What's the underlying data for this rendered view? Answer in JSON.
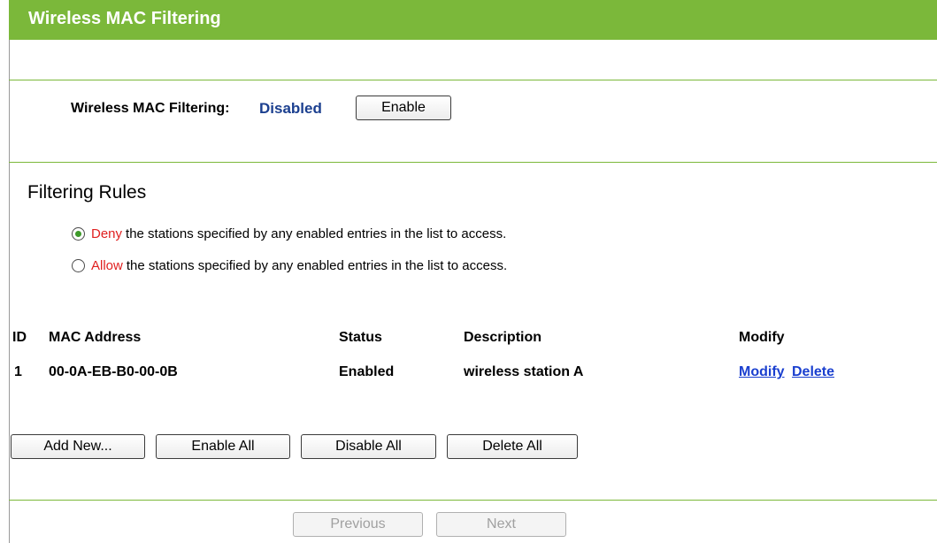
{
  "header": {
    "title": "Wireless MAC Filtering"
  },
  "status": {
    "label": "Wireless MAC Filtering:",
    "value": "Disabled",
    "enable_button": "Enable"
  },
  "rules": {
    "title": "Filtering Rules",
    "options": [
      {
        "keyword": "Deny",
        "text": "the stations specified by any enabled entries in the list to access.",
        "checked": true
      },
      {
        "keyword": "Allow",
        "text": "the stations specified by any enabled entries in the list to access.",
        "checked": false
      }
    ]
  },
  "table": {
    "columns": [
      "ID",
      "MAC Address",
      "Status",
      "Description",
      "Modify"
    ],
    "rows": [
      {
        "id": "1",
        "mac": "00-0A-EB-B0-00-0B",
        "status": "Enabled",
        "description": "wireless station A",
        "modify": "Modify",
        "delete": "Delete"
      }
    ]
  },
  "actions": {
    "add_new": "Add New...",
    "enable_all": "Enable All",
    "disable_all": "Disable All",
    "delete_all": "Delete All"
  },
  "pager": {
    "previous": "Previous",
    "next": "Next"
  }
}
